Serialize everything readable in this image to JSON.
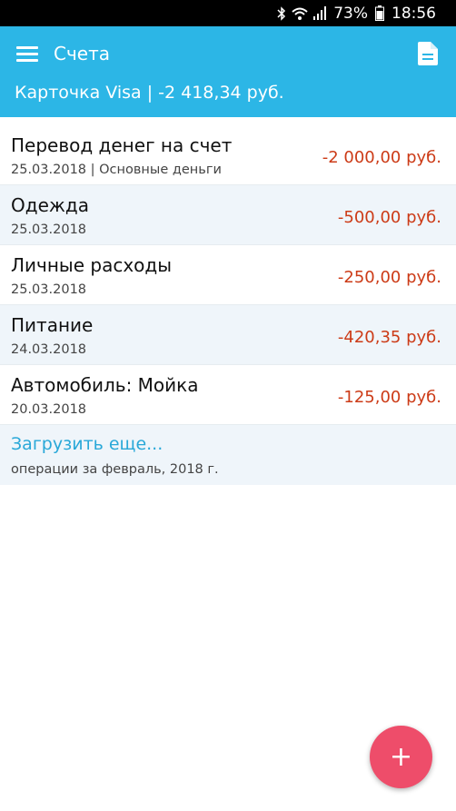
{
  "status_bar": {
    "battery": "73%",
    "time": "18:56"
  },
  "app_bar": {
    "title": "Счета",
    "account": "Карточка Visa | -2 418,34 руб."
  },
  "transactions": [
    {
      "title": "Перевод денег на счет",
      "subtitle": "25.03.2018 | Основные деньги",
      "amount": "-2 000,00 руб."
    },
    {
      "title": "Одежда",
      "subtitle": "25.03.2018",
      "amount": "-500,00 руб."
    },
    {
      "title": "Личные расходы",
      "subtitle": "25.03.2018",
      "amount": "-250,00 руб."
    },
    {
      "title": "Питание",
      "subtitle": "24.03.2018",
      "amount": "-420,35 руб."
    },
    {
      "title": "Автомобиль: Мойка",
      "subtitle": "20.03.2018",
      "amount": "-125,00 руб."
    }
  ],
  "load_more": {
    "title": "Загрузить еще...",
    "subtitle": "операции за февраль, 2018 г."
  },
  "fab": {
    "label": "+"
  },
  "icons": {
    "menu": "menu-icon",
    "document": "document-icon",
    "add": "plus-icon"
  },
  "colors": {
    "app_bar": "#2cb6e6",
    "amount": "#cc3b17",
    "link": "#29a8d8",
    "fab": "#ee4d6a",
    "alt_row": "#eff5fa"
  }
}
